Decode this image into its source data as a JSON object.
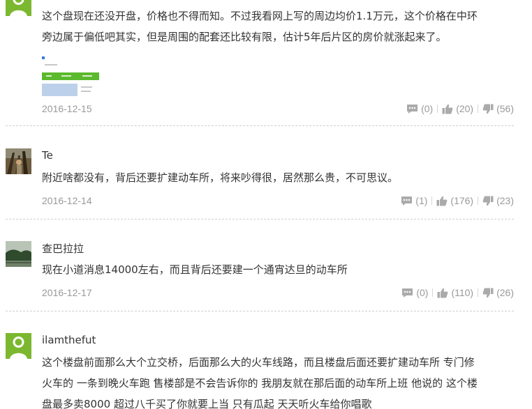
{
  "comments": [
    {
      "username": "",
      "text_lines": [
        "这个盘现在还没开盘，价格也不得而知。不过我看网上写的周边均价1.1万元，这个价格在中环",
        "旁边属于偏低吧其实，但是周围的配套还比较有限，估计5年后片区的房价就涨起来了。"
      ],
      "date": "2016-12-15",
      "reply_count": "(0)",
      "like_count": "(20)",
      "dislike_count": "(56)"
    },
    {
      "username": "Te",
      "text_lines": [
        "附近啥都没有，背后还要扩建动车所，将来吵得很，居然那么贵，不可思议。"
      ],
      "date": "2016-12-14",
      "reply_count": "(1)",
      "like_count": "(176)",
      "dislike_count": "(23)"
    },
    {
      "username": "查巴拉拉",
      "text_lines": [
        "现在小道消息14000左右，而且背后还要建一个通宵达旦的动车所"
      ],
      "date": "2016-12-17",
      "reply_count": "(0)",
      "like_count": "(110)",
      "dislike_count": "(26)"
    },
    {
      "username": "ilamthefut",
      "text_lines": [
        "这个楼盘前面那么大个立交桥，后面那么大的火车线路，而且楼盘后面还要扩建动车所 专门修",
        "火车的 一条到晚火车跑 售楼部是不会告诉你的 我朋友就在那后面的动车所上班 他说的 这个楼",
        "盘最多卖8000 超过八千买了你就要上当 只有瓜起 天天听火车给你唱歌"
      ],
      "date": "",
      "reply_count": "",
      "like_count": "",
      "dislike_count": ""
    }
  ],
  "colors": {
    "text": "#333333",
    "meta": "#999999",
    "icon": "#aaaaaa",
    "default_avatar": "#7cb82f",
    "thumb_nav": "#5bb92e"
  },
  "icons": {
    "reply": "comment-bubble-icon",
    "like": "thumbs-up-icon",
    "dislike": "thumbs-down-icon",
    "default_avatar": "default-user-avatar-icon"
  }
}
